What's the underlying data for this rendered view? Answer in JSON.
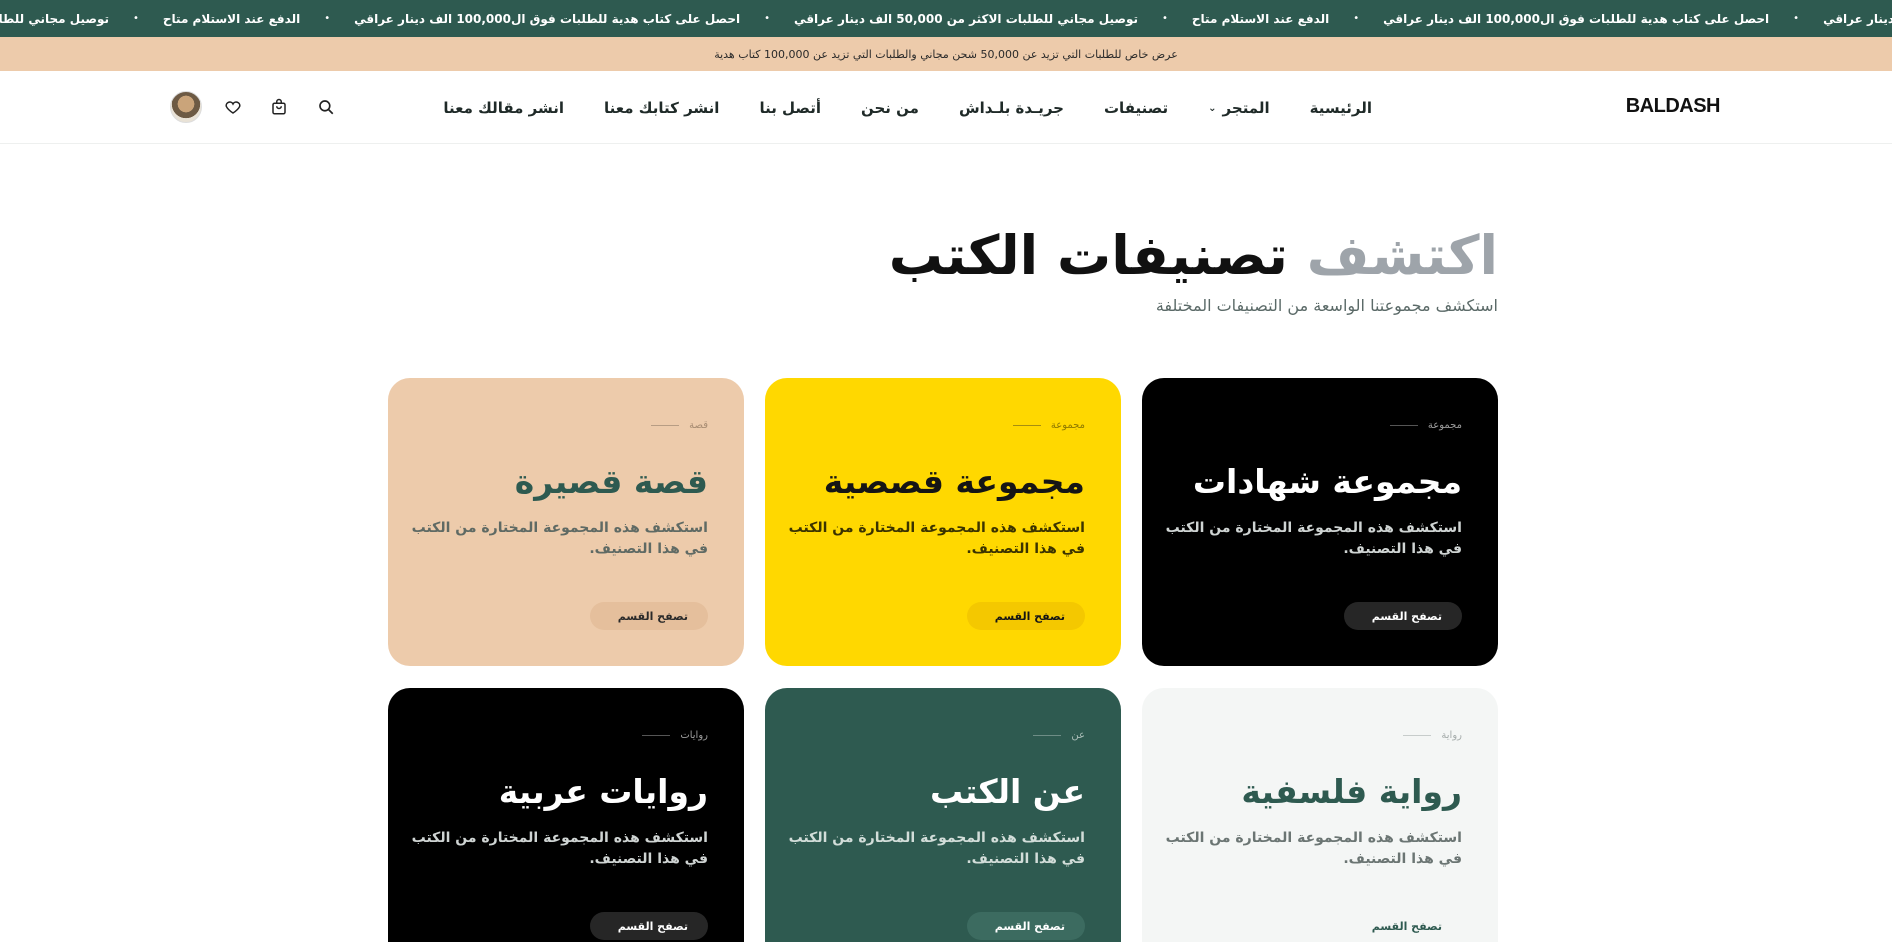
{
  "ticker": {
    "items": [
      "احصل على كتاب هدية للطلبات فوق ال100,000 الف دينار عراقي",
      "الدفع عند الاستلام متاح",
      "توصيل مجاني للطلبات الاكثر من 50,000 الف دينار عراقي",
      "احصل على كتاب هدية للطلبات فوق ال100,000 الف دينار عراقي",
      "الدفع عند الاستلام متاح",
      "توصيل مجاني للطلبات الاكثر من 50,000 الف دينار عراقي"
    ],
    "lead_fragment": "دينار عراقي"
  },
  "promo": {
    "text": "عرض خاص للطلبات التي تزيد عن 50,000 شحن مجاني والطلبات التي تزيد عن 100,000 كتاب هدية"
  },
  "header": {
    "logo": "BALDASH",
    "nav": [
      {
        "label": "الرئيسية"
      },
      {
        "label": "المتجر"
      },
      {
        "label": "تصنيفات"
      },
      {
        "label": "جريـدة بلـداش"
      },
      {
        "label": "من نحن"
      },
      {
        "label": "أتصل بنا"
      },
      {
        "label": "انشر كتابك معنا"
      },
      {
        "label": "انشر مقالك معنا"
      }
    ],
    "icons": [
      "search-icon",
      "bag-icon",
      "heart-icon",
      "avatar"
    ]
  },
  "hero": {
    "title_muted": "اكتشف",
    "title_main": "تصنيفات الكتب",
    "subtitle": "استكشف مجموعتنا الواسعة من التصنيفات المختلفة"
  },
  "cards": [
    {
      "tag": "مجموعة",
      "title": "مجموعة شهادات",
      "desc": "استكشف هذه المجموعة المختارة من الكتب في هذا التصنيف.",
      "button": "تصفح القسم",
      "color": "#000000"
    },
    {
      "tag": "مجموعة",
      "title": "مجموعة قصصية",
      "desc": "استكشف هذه المجموعة المختارة من الكتب في هذا التصنيف.",
      "button": "تصفح القسم",
      "color": "#ffd800"
    },
    {
      "tag": "قصة",
      "title": "قصة قصيرة",
      "desc": "استكشف هذه المجموعة المختارة من الكتب في هذا التصنيف.",
      "button": "تصفح القسم",
      "color": "#edcbab"
    },
    {
      "tag": "رواية",
      "title": "رواية فلسفية",
      "desc": "استكشف هذه المجموعة المختارة من الكتب في هذا التصنيف.",
      "button": "تصفح القسم",
      "color": "#f4f6f5"
    },
    {
      "tag": "عن",
      "title": "عن الكتب",
      "desc": "استكشف هذه المجموعة المختارة من الكتب في هذا التصنيف.",
      "button": "تصفح القسم",
      "color": "#2e5a50"
    },
    {
      "tag": "روايات",
      "title": "روايات عربية",
      "desc": "استكشف هذه المجموعة المختارة من الكتب في هذا التصنيف.",
      "button": "تصفح القسم",
      "color": "#000000"
    }
  ]
}
